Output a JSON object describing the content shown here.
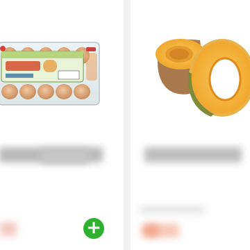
{
  "products": [
    {
      "name": "",
      "price": "",
      "image_icon": "egg-carton-image",
      "add_icon": "plus-icon",
      "add_label": "+"
    },
    {
      "name": "",
      "price": "",
      "image_icon": "pumpkin-image"
    }
  ],
  "colors": {
    "add_button": "#2fb12f",
    "background": "#f2f2f2",
    "card": "#ffffff"
  }
}
